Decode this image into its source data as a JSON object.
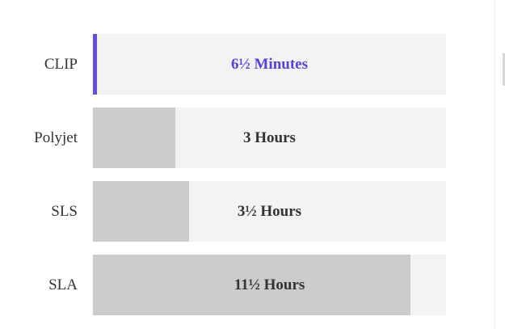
{
  "chart_data": {
    "type": "bar",
    "orientation": "horizontal",
    "categories": [
      "CLIP",
      "Polyjet",
      "SLS",
      "SLA"
    ],
    "values_hours": [
      0.1083,
      3,
      3.5,
      11.5
    ],
    "xlim_hours": [
      0,
      12.8
    ],
    "value_labels": [
      "6½ Minutes",
      "3 Hours",
      "3½ Hours",
      "11½ Hours"
    ],
    "highlight_index": 0,
    "colors": {
      "highlight": "#6a4be0",
      "highlight_text": "#5b3fd8",
      "bar": "#cccccc",
      "track": "#f3f3f3",
      "text": "#333333"
    },
    "title": "",
    "xlabel": "",
    "ylabel": "",
    "grid": false,
    "legend": "none"
  }
}
